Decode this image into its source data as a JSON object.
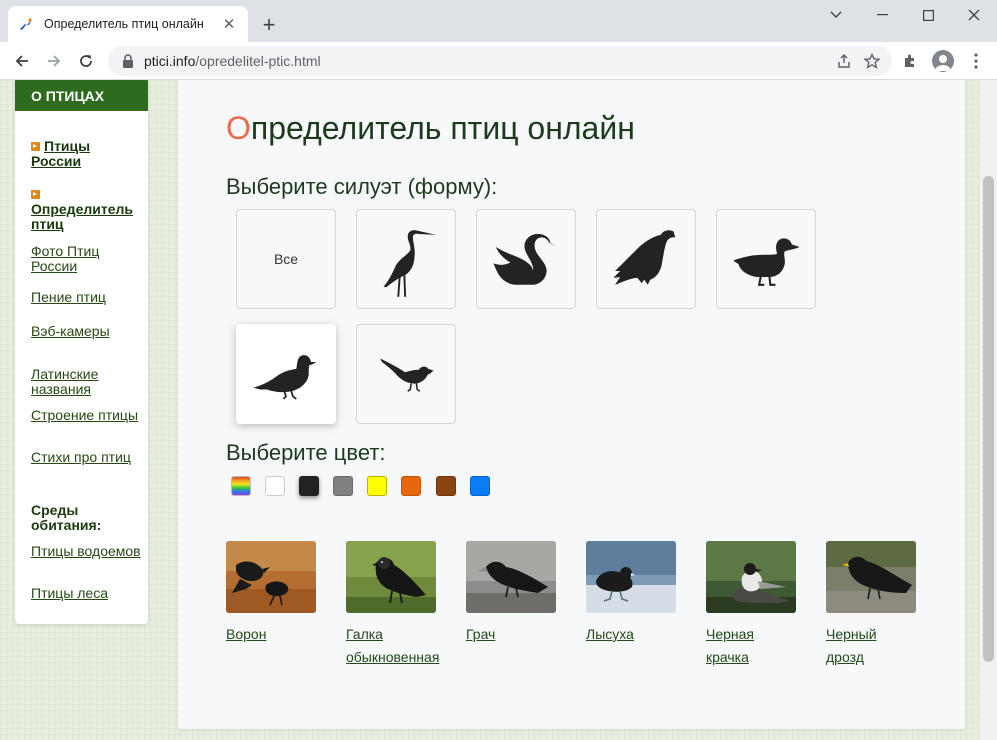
{
  "browser": {
    "tab_title": "Определитель птиц онлайн",
    "url_domain": "ptici.info",
    "url_path": "/opredelitel-ptic.html"
  },
  "sidebar": {
    "header": "О ПТИЦАХ",
    "links": [
      {
        "label": "Птицы России",
        "bold": true
      },
      {
        "label": "Определитель птиц",
        "bold": true
      },
      {
        "label": "Фото Птиц России",
        "bold": false
      },
      {
        "label": "Пение птиц",
        "bold": false
      },
      {
        "label": "Вэб-камеры",
        "bold": false
      },
      {
        "label": "Латинские названия",
        "bold": false
      },
      {
        "label": "Строение птицы",
        "bold": false
      },
      {
        "label": "Стихи про птиц",
        "bold": false
      }
    ],
    "habitat_heading": "Среды обитания:",
    "habitat_links": [
      "Птицы водоемов",
      "Птицы леса"
    ]
  },
  "main": {
    "title_first_letter": "О",
    "title_rest": "пределитель птиц онлайн",
    "silhouette_heading": "Выберите силуэт (форму):",
    "silhouette_all_label": "Все",
    "silhouettes": [
      {
        "name": "heron",
        "selected": false
      },
      {
        "name": "swan",
        "selected": false
      },
      {
        "name": "eagle",
        "selected": false
      },
      {
        "name": "duck",
        "selected": false
      },
      {
        "name": "pigeon",
        "selected": true
      },
      {
        "name": "sparrow",
        "selected": false
      }
    ],
    "color_heading": "Выберите цвет:",
    "colors": [
      {
        "name": "rainbow",
        "hex": "rainbow"
      },
      {
        "name": "white",
        "hex": "#ffffff"
      },
      {
        "name": "black",
        "hex": "#222222",
        "selected": true
      },
      {
        "name": "gray",
        "hex": "#808080"
      },
      {
        "name": "yellow",
        "hex": "#ffff00"
      },
      {
        "name": "orange",
        "hex": "#e8660a"
      },
      {
        "name": "brown",
        "hex": "#8b4513"
      },
      {
        "name": "blue",
        "hex": "#0a7df5"
      }
    ],
    "results": [
      {
        "line1": "Ворон",
        "line2": ""
      },
      {
        "line1": "Галка",
        "line2": "обыкновенная"
      },
      {
        "line1": "Грач",
        "line2": ""
      },
      {
        "line1": "Лысуха",
        "line2": ""
      },
      {
        "line1": "Черная",
        "line2": "крачка"
      },
      {
        "line1": "Черный",
        "line2": "дрозд"
      }
    ]
  }
}
